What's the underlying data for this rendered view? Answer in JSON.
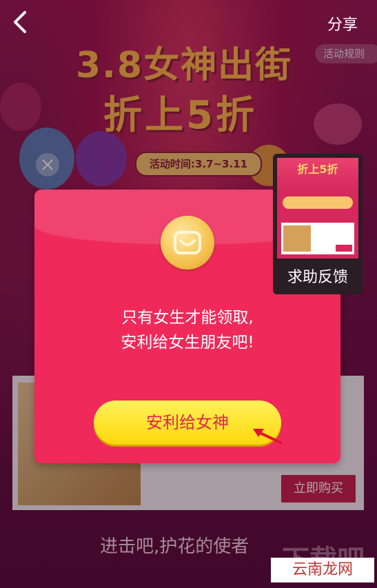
{
  "header": {
    "share_label": "分享"
  },
  "banner": {
    "title": "3.8女神出街",
    "subtitle": "折上5折",
    "rules_label": "活动规则",
    "time_label": "活动时间:3.7~3.11"
  },
  "envelope": {
    "message_line1": "只有女生才能领取,",
    "message_line2": "安利给女生朋友吧!",
    "cta_label": "安利给女神"
  },
  "feedback": {
    "thumb_title": "折上5折",
    "label": "求助反馈"
  },
  "product": {
    "buy_label": "立即购买"
  },
  "footer": {
    "slogan": "进击吧,护花的使者",
    "watermark_text": "下载吧",
    "watermark_badge": "云南龙网"
  },
  "colors": {
    "accent": "#ef2a5b",
    "cta_bg": "#ffe22a",
    "cta_text": "#e0264e",
    "banner_gold": "#ffb84a"
  },
  "icons": {
    "back": "chevron-left-icon",
    "close": "close-icon",
    "coin": "smile-coin-icon",
    "arrow": "red-arrow-icon"
  }
}
